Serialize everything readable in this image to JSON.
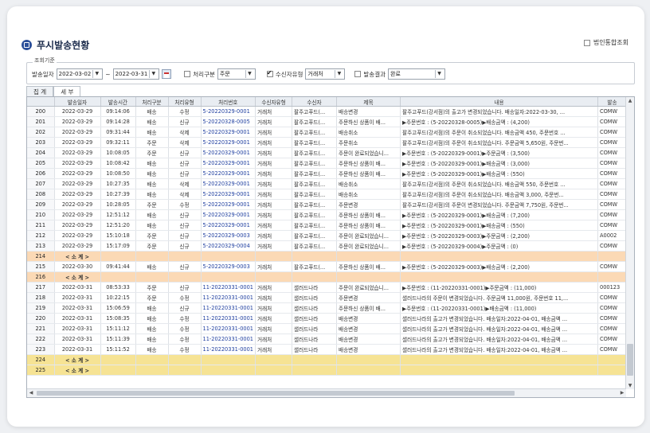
{
  "app": {
    "title": "푸시발송현황",
    "corp_check_label": "법인통합조회",
    "corp_checked": false
  },
  "criteria": {
    "legend": "조회기준",
    "date_label": "발송일자",
    "date_from": "2022-03-02",
    "date_sep": "~",
    "date_to": "2022-03-31",
    "process_type_label": "처리구분",
    "process_type_checked": false,
    "process_type_value": "주문",
    "receiver_type_label": "수신자유형",
    "receiver_type_checked": true,
    "receiver_type_value": "거래처",
    "send_result_label": "발송결과",
    "send_result_checked": false,
    "send_result_value": "완료"
  },
  "tabs": [
    {
      "label": "집 계"
    },
    {
      "label": "세 부"
    }
  ],
  "grid": {
    "columns": [
      "",
      "발송일자",
      "발송시간",
      "처리구분",
      "처리유형",
      "처리번호",
      "수신자유형",
      "수신자",
      "제목",
      "내용",
      "발송"
    ],
    "subtotal_label": "< 소 계 >",
    "rows": [
      {
        "n": "200",
        "date": "2022-03-29",
        "time": "09:14:06",
        "cat": "배송",
        "type": "수정",
        "no": "5-20220329-0001",
        "rtype": "거래처",
        "recv": "팔주고푸드(...",
        "subj": "배송변경",
        "content": "팔주고푸드(강서점)의 출고가 변경되었습니다. 배송일자:2022-03-30, ...",
        "last": "COMW"
      },
      {
        "n": "201",
        "date": "2022-03-29",
        "time": "09:14:28",
        "cat": "배송",
        "type": "신규",
        "no": "5-20220328-0005",
        "rtype": "거래처",
        "recv": "팔주고푸드(...",
        "subj": "주문하신 상품이 배...",
        "content": "▶주문번호 : (5-20220328-0005)▶배송금액 : (4,200)",
        "last": "COMW"
      },
      {
        "n": "202",
        "date": "2022-03-29",
        "time": "09:31:44",
        "cat": "배송",
        "type": "삭제",
        "no": "5-20220329-0001",
        "rtype": "거래처",
        "recv": "팔주고푸드(...",
        "subj": "배송취소",
        "content": "팔주고푸드(강서점)의 주문이 취소되었습니다. 배송금액 450, 주문번호 ...",
        "last": "COMW"
      },
      {
        "n": "203",
        "date": "2022-03-29",
        "time": "09:32:11",
        "cat": "주문",
        "type": "삭제",
        "no": "5-20220329-0001",
        "rtype": "거래처",
        "recv": "팔주고푸드(...",
        "subj": "주문취소",
        "content": "팔주고푸드(강서점)의 주문이 취소되었습니다. 주문금액 5,650원, 주문번...",
        "last": "COMW"
      },
      {
        "n": "204",
        "date": "2022-03-29",
        "time": "10:08:05",
        "cat": "주문",
        "type": "신규",
        "no": "5-20220329-0001",
        "rtype": "거래처",
        "recv": "팔주고푸드(...",
        "subj": "주문이 완료되었습니...",
        "content": "▶주문번호 : (5-20220329-0001)▶주문금액 : (3,500)",
        "last": "COMW"
      },
      {
        "n": "205",
        "date": "2022-03-29",
        "time": "10:08:42",
        "cat": "배송",
        "type": "신규",
        "no": "5-20220329-0001",
        "rtype": "거래처",
        "recv": "팔주고푸드(...",
        "subj": "주문하신 상품이 배...",
        "content": "▶주문번호 : (5-20220329-0001)▶배송금액 : (3,000)",
        "last": "COMW"
      },
      {
        "n": "206",
        "date": "2022-03-29",
        "time": "10:08:50",
        "cat": "배송",
        "type": "신규",
        "no": "5-20220329-0001",
        "rtype": "거래처",
        "recv": "팔주고푸드(...",
        "subj": "주문하신 상품이 배...",
        "content": "▶주문번호 : (5-20220329-0001)▶배송금액 : (550)",
        "last": "COMW"
      },
      {
        "n": "207",
        "date": "2022-03-29",
        "time": "10:27:35",
        "cat": "배송",
        "type": "삭제",
        "no": "5-20220329-0001",
        "rtype": "거래처",
        "recv": "팔주고푸드(...",
        "subj": "배송취소",
        "content": "팔주고푸드(강서점)의 주문이 취소되었습니다. 배송금액 550, 주문번호 ...",
        "last": "COMW"
      },
      {
        "n": "208",
        "date": "2022-03-29",
        "time": "10:27:39",
        "cat": "배송",
        "type": "삭제",
        "no": "5-20220329-0001",
        "rtype": "거래처",
        "recv": "팔주고푸드(...",
        "subj": "배송취소",
        "content": "팔주고푸드(강서점)의 주문이 취소되었습니다. 배송금액 3,000, 주문번...",
        "last": "COMW"
      },
      {
        "n": "209",
        "date": "2022-03-29",
        "time": "10:28:05",
        "cat": "주문",
        "type": "수정",
        "no": "5-20220329-0001",
        "rtype": "거래처",
        "recv": "팔주고푸드(...",
        "subj": "주문변경",
        "content": "팔주고푸드(강서점)의 주문이 변경되었습니다. 주문금액 7,750원, 주문번...",
        "last": "COMW"
      },
      {
        "n": "210",
        "date": "2022-03-29",
        "time": "12:51:12",
        "cat": "배송",
        "type": "신규",
        "no": "5-20220329-0001",
        "rtype": "거래처",
        "recv": "팔주고푸드(...",
        "subj": "주문하신 상품이 배...",
        "content": "▶주문번호 : (5-20220329-0001)▶배송금액 : (7,200)",
        "last": "COMW"
      },
      {
        "n": "211",
        "date": "2022-03-29",
        "time": "12:51:20",
        "cat": "배송",
        "type": "신규",
        "no": "5-20220329-0001",
        "rtype": "거래처",
        "recv": "팔주고푸드(...",
        "subj": "주문하신 상품이 배...",
        "content": "▶주문번호 : (5-20220329-0001)▶배송금액 : (550)",
        "last": "COMW"
      },
      {
        "n": "212",
        "date": "2022-03-29",
        "time": "15:10:18",
        "cat": "주문",
        "type": "신규",
        "no": "5-20220329-0003",
        "rtype": "거래처",
        "recv": "팔주고푸드(...",
        "subj": "주문이 완료되었습니...",
        "content": "▶주문번호 : (5-20220329-0003)▶주문금액 : (2,200)",
        "last": "A0002"
      },
      {
        "n": "213",
        "date": "2022-03-29",
        "time": "15:17:09",
        "cat": "주문",
        "type": "신규",
        "no": "5-20220329-0004",
        "rtype": "거래처",
        "recv": "팔주고푸드(...",
        "subj": "주문이 완료되었습니...",
        "content": "▶주문번호 : (5-20220329-0004)▶주문금액 : (0)",
        "last": "COMW"
      },
      {
        "n": "214",
        "subtotal": "orange"
      },
      {
        "n": "215",
        "date": "2022-03-30",
        "time": "09:41:44",
        "cat": "배송",
        "type": "신규",
        "no": "5-20220329-0003",
        "rtype": "거래처",
        "recv": "팔주고푸드(...",
        "subj": "주문하신 상품이 배...",
        "content": "▶주문번호 : (5-20220329-0003)▶배송금액 : (2,200)",
        "last": "COMW"
      },
      {
        "n": "216",
        "subtotal": "orange"
      },
      {
        "n": "217",
        "date": "2022-03-31",
        "time": "08:53:33",
        "cat": "주문",
        "type": "신규",
        "no": "11-20220331-0001",
        "rtype": "거래처",
        "recv": "샐러드나라",
        "subj": "주문이 완료되었습니...",
        "content": "▶주문번호 : (11-20220331-0001)▶주문금액 : (11,000)",
        "last": "000123"
      },
      {
        "n": "218",
        "date": "2022-03-31",
        "time": "10:22:15",
        "cat": "주문",
        "type": "수정",
        "no": "11-20220331-0001",
        "rtype": "거래처",
        "recv": "샐러드나라",
        "subj": "주문변경",
        "content": "샐러드나라의 주문이 변경되었습니다. 주문금액 11,000원, 주문번호 11,...",
        "last": "COMW"
      },
      {
        "n": "219",
        "date": "2022-03-31",
        "time": "15:06:59",
        "cat": "배송",
        "type": "신규",
        "no": "11-20220331-0001",
        "rtype": "거래처",
        "recv": "샐러드나라",
        "subj": "주문하신 상품이 배...",
        "content": "▶주문번호 : (11-20220331-0001)▶배송금액 : (11,000)",
        "last": "COMW"
      },
      {
        "n": "220",
        "date": "2022-03-31",
        "time": "15:08:35",
        "cat": "배송",
        "type": "수정",
        "no": "11-20220331-0001",
        "rtype": "거래처",
        "recv": "샐러드나라",
        "subj": "배송변경",
        "content": "샐러드나라의 출고가 변경되었습니다. 배송일자:2022-04-01, 배송금액 ...",
        "last": "COMW"
      },
      {
        "n": "221",
        "date": "2022-03-31",
        "time": "15:11:12",
        "cat": "배송",
        "type": "수정",
        "no": "11-20220331-0001",
        "rtype": "거래처",
        "recv": "샐러드나라",
        "subj": "배송변경",
        "content": "샐러드나라의 출고가 변경되었습니다. 배송일자:2022-04-01, 배송금액 ...",
        "last": "COMW"
      },
      {
        "n": "222",
        "date": "2022-03-31",
        "time": "15:11:39",
        "cat": "배송",
        "type": "수정",
        "no": "11-20220331-0001",
        "rtype": "거래처",
        "recv": "샐러드나라",
        "subj": "배송변경",
        "content": "샐러드나라의 출고가 변경되었습니다. 배송일자:2022-04-01, 배송금액 ...",
        "last": "COMW"
      },
      {
        "n": "223",
        "date": "2022-03-31",
        "time": "15:11:52",
        "cat": "배송",
        "type": "수정",
        "no": "11-20220331-0001",
        "rtype": "거래처",
        "recv": "샐러드나라",
        "subj": "배송변경",
        "content": "샐러드나라의 출고가 변경되었습니다. 배송일자:2022-04-01, 배송금액 ...",
        "last": "COMW"
      },
      {
        "n": "224",
        "subtotal": "yellow"
      },
      {
        "n": "225",
        "subtotal": "yellow"
      }
    ]
  },
  "colors": {
    "title": "#1d2d4d",
    "process_no": "#1f3fa0",
    "subtotal_orange": "#fbd9b5",
    "subtotal_yellow": "#f6e394"
  },
  "icons": {
    "title": "menu-doc-icon",
    "calendar": "calendar-icon",
    "dropdown": "chevron-down-icon"
  }
}
